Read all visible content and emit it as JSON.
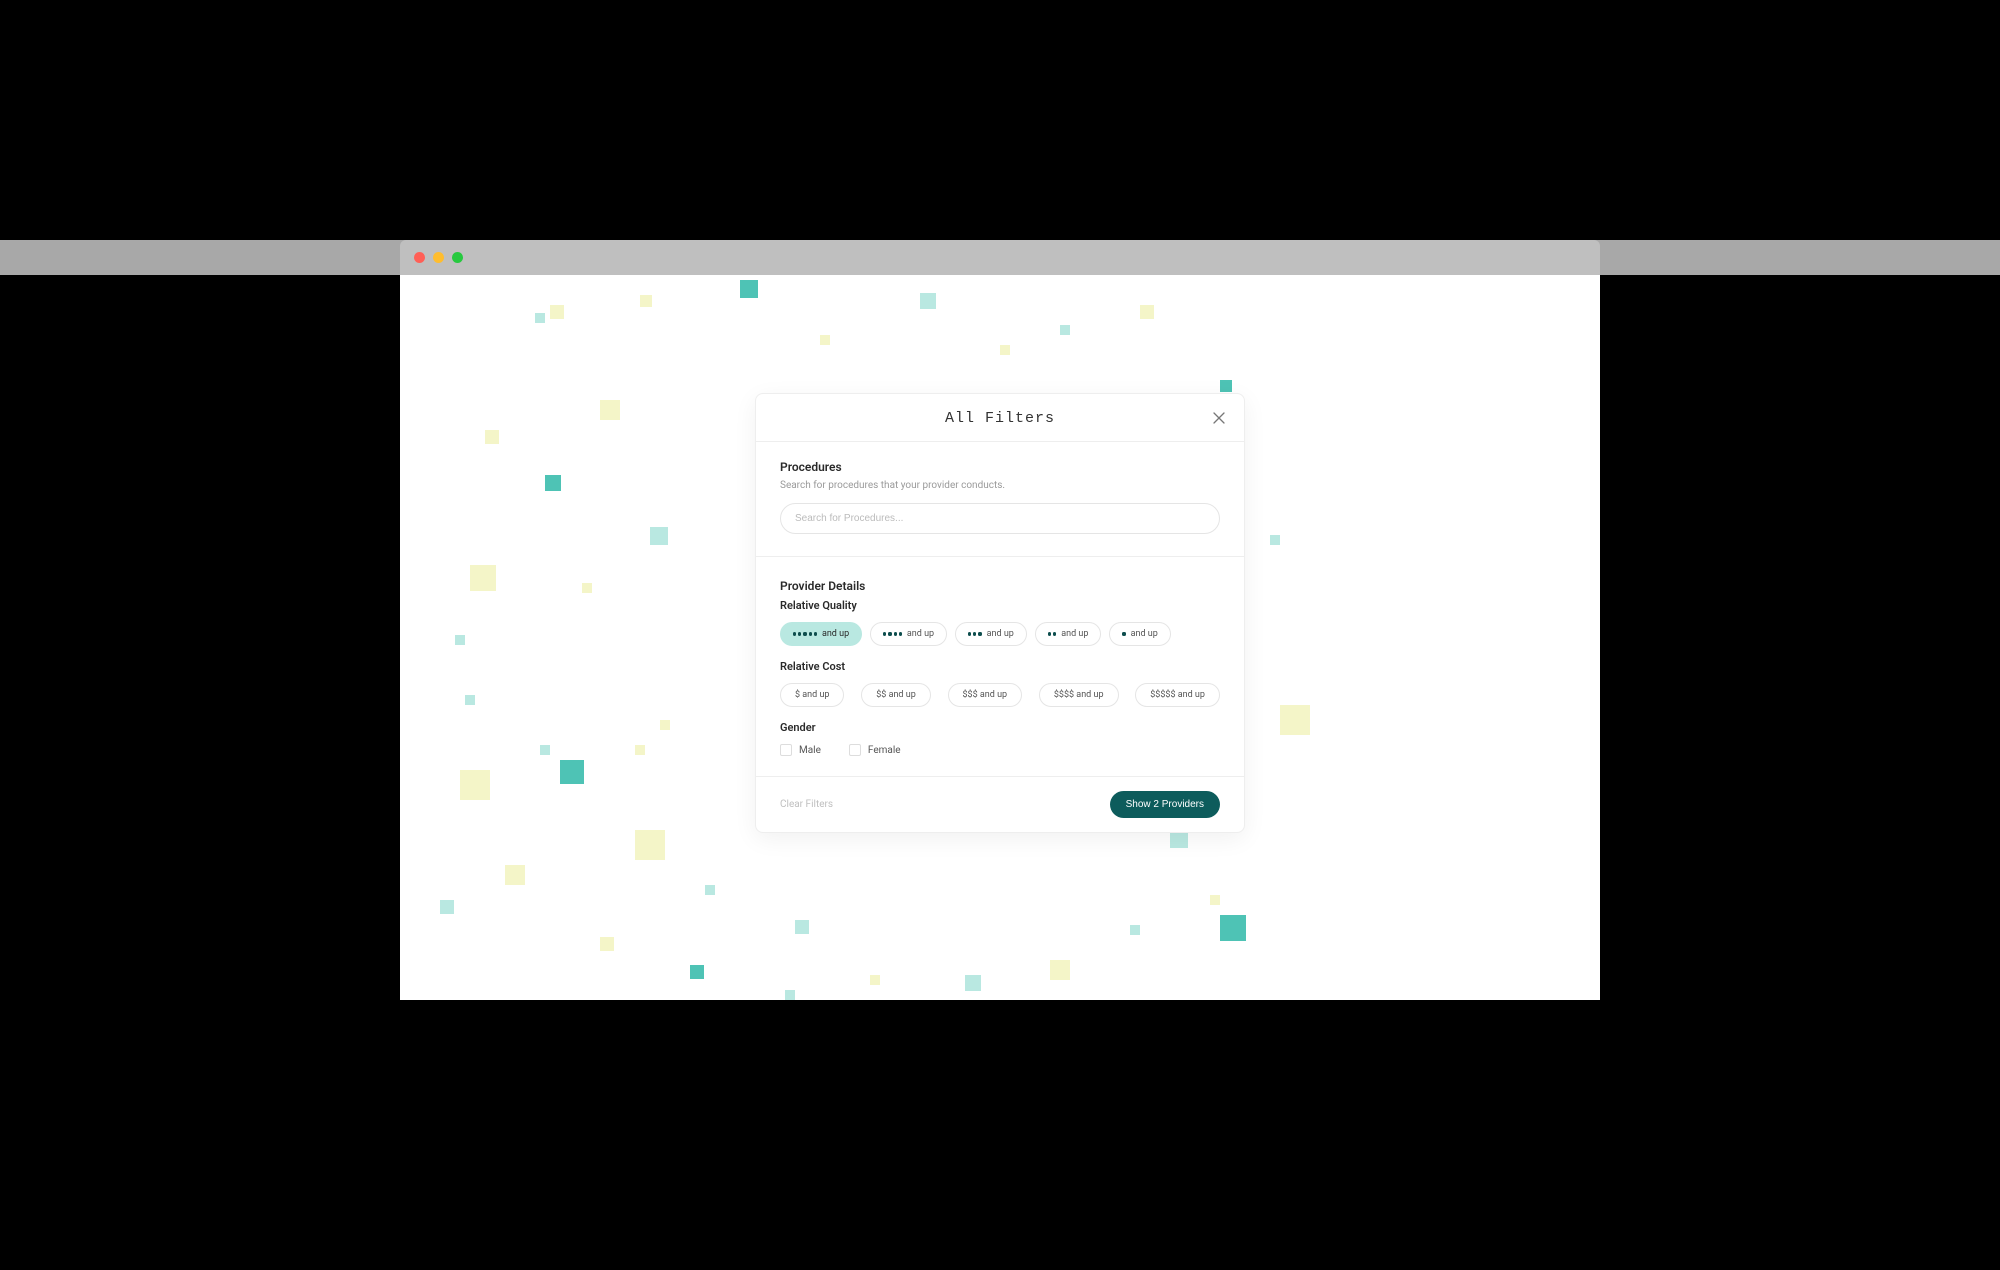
{
  "modal": {
    "title": "All Filters",
    "sections": {
      "procedures": {
        "heading": "Procedures",
        "description": "Search for procedures that your provider conducts.",
        "search_placeholder": "Search for Procedures..."
      },
      "provider_details": {
        "heading": "Provider Details",
        "relative_quality": {
          "label": "Relative Quality",
          "options": [
            {
              "dots": 5,
              "suffix": "and up",
              "selected": true
            },
            {
              "dots": 4,
              "suffix": "and up",
              "selected": false
            },
            {
              "dots": 3,
              "suffix": "and up",
              "selected": false
            },
            {
              "dots": 2,
              "suffix": "and up",
              "selected": false
            },
            {
              "dots": 1,
              "suffix": "and up",
              "selected": false
            }
          ]
        },
        "relative_cost": {
          "label": "Relative Cost",
          "options": [
            {
              "label": "$ and up"
            },
            {
              "label": "$$ and up"
            },
            {
              "label": "$$$ and up"
            },
            {
              "label": "$$$$ and up"
            },
            {
              "label": "$$$$$ and up"
            }
          ]
        },
        "gender": {
          "label": "Gender",
          "options": [
            {
              "label": "Male"
            },
            {
              "label": "Female"
            }
          ]
        }
      }
    },
    "footer": {
      "clear_label": "Clear Filters",
      "show_label": "Show 2 Providers"
    }
  },
  "colors": {
    "teal": "#4ec3b5",
    "teal_light": "#b9e8e1",
    "yellow": "#f4f5c8",
    "primary_button": "#0d5c5c"
  }
}
